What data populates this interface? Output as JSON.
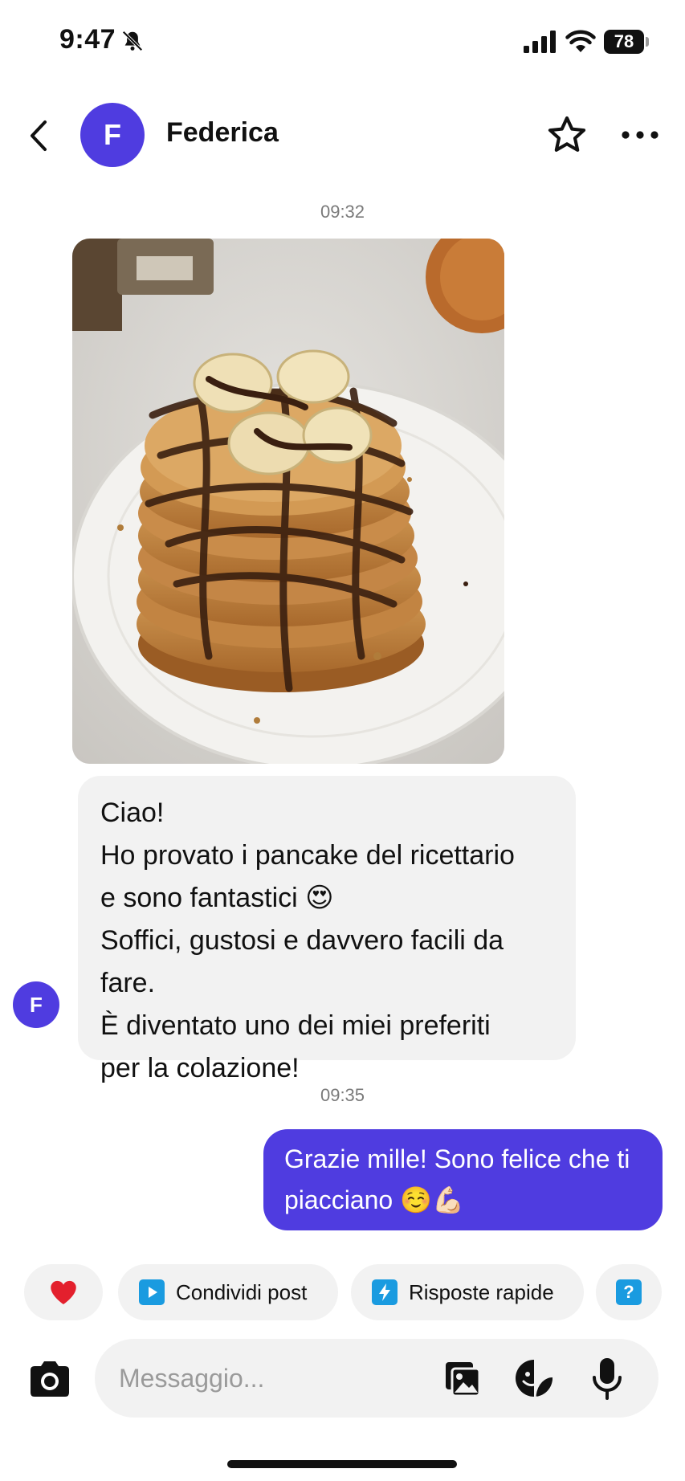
{
  "status_bar": {
    "time": "9:47",
    "battery": "78",
    "icons": [
      "bell-slash-icon",
      "cellular-signal-icon",
      "wifi-icon",
      "battery-icon"
    ]
  },
  "header": {
    "contact_name": "Federica",
    "avatar_initial": "F",
    "icons": [
      "chevron-left-icon",
      "star-outline-icon",
      "more-horizontal-icon"
    ]
  },
  "conversation": {
    "timestamp_1": "09:32",
    "incoming_message": "Ciao!\nHo provato i pancake del ricettario\ne sono fantastici 😍\nSoffici, gustosi e davvero facili da fare.\nÈ diventato uno dei miei preferiti\nper la colazione!",
    "sender_avatar_initial": "F",
    "timestamp_2": "09:35",
    "outgoing_message": "Grazie mille! Sono felice che ti\npiacciano ☺️💪🏻"
  },
  "quick_actions": {
    "share_post": "Condividi post",
    "quick_replies": "Risposte rapide",
    "help_glyph": "?",
    "icons": [
      "heart-icon",
      "play-square-icon",
      "lightning-square-icon",
      "question-square-icon"
    ]
  },
  "composer": {
    "placeholder": "Messaggio...",
    "value": "",
    "icons": [
      "camera-icon",
      "gallery-icon",
      "sticker-icon",
      "microphone-icon"
    ]
  },
  "colors": {
    "accent": "#4f3ce0",
    "bubble_incoming": "#f2f2f2",
    "heart": "#e3202d",
    "chip_icon": "#1a9be0",
    "timestamp": "#7a7a7a"
  }
}
